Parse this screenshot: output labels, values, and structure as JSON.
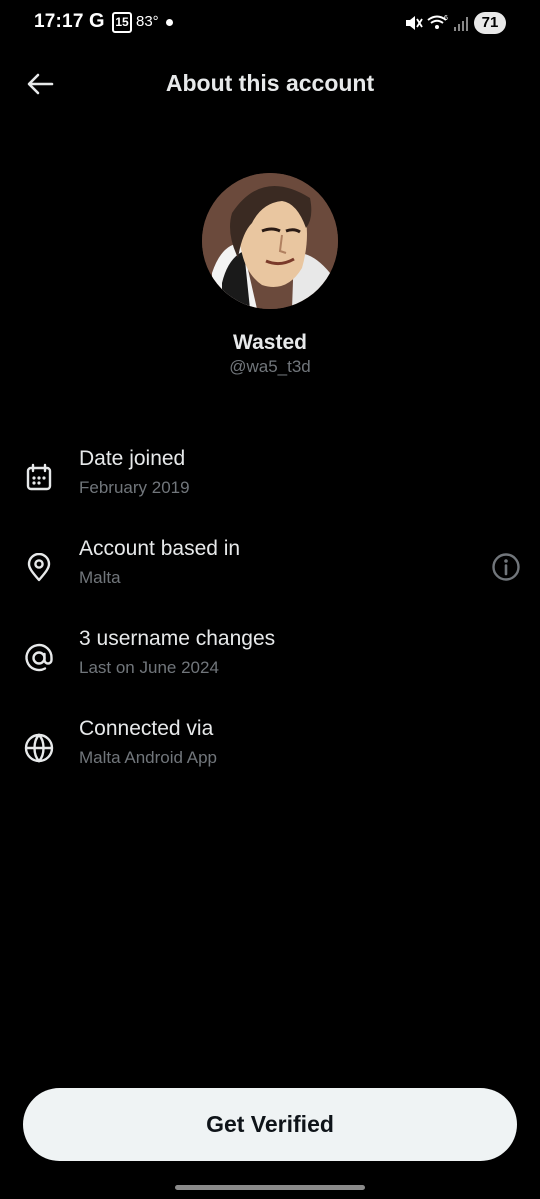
{
  "status_bar": {
    "time": "17:17",
    "g_label": "G",
    "calendar_day": "15",
    "temperature": "83°",
    "battery": "71"
  },
  "header": {
    "title": "About this account",
    "back_icon": "arrow-left-icon"
  },
  "profile": {
    "display_name": "Wasted",
    "handle": "@wa5_t3d"
  },
  "info": [
    {
      "icon": "calendar-icon",
      "title": "Date joined",
      "subtitle": "February 2019"
    },
    {
      "icon": "location-pin-icon",
      "title": "Account based in",
      "subtitle": "Malta",
      "action_icon": "info-icon"
    },
    {
      "icon": "at-sign-icon",
      "title": "3 username changes",
      "subtitle": "Last on June 2024"
    },
    {
      "icon": "globe-icon",
      "title": "Connected via",
      "subtitle": "Malta Android App"
    }
  ],
  "footer": {
    "verify_label": "Get Verified"
  },
  "colors": {
    "background": "#000000",
    "primary_text": "#e7e9ea",
    "secondary_text": "#71767b",
    "button_bg": "#eff3f4",
    "button_text": "#0f1419"
  }
}
